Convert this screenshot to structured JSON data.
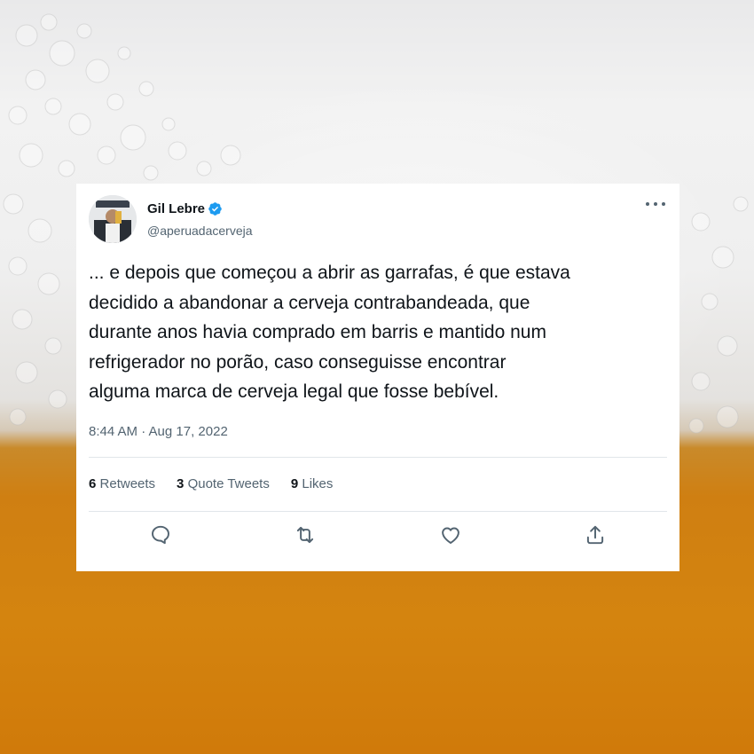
{
  "tweet": {
    "author_name": "Gil Lebre",
    "author_handle": "@aperuadacerveja",
    "text": "... e depois que começou a abrir as garrafas, é que estava\ndecidido a abandonar a cerveja contrabandeada, que\ndurante anos havia comprado em barris e mantido num\nrefrigerador no porão, caso conseguisse encontrar\nalguma marca de cerveja legal que fosse bebível.",
    "timestamp": "8:44 AM · Aug 17, 2022",
    "stats": {
      "retweets_count": "6",
      "retweets_label": "Retweets",
      "quote_count": "3",
      "quote_label": "Quote Tweets",
      "likes_count": "9",
      "likes_label": "Likes"
    },
    "actions": [
      "reply-icon",
      "retweet-icon",
      "like-icon",
      "share-icon"
    ]
  },
  "colors": {
    "text_primary": "#0f1419",
    "text_secondary": "#536471",
    "verified_blue": "#1d9bf0",
    "beer_orange": "#d4840f"
  }
}
